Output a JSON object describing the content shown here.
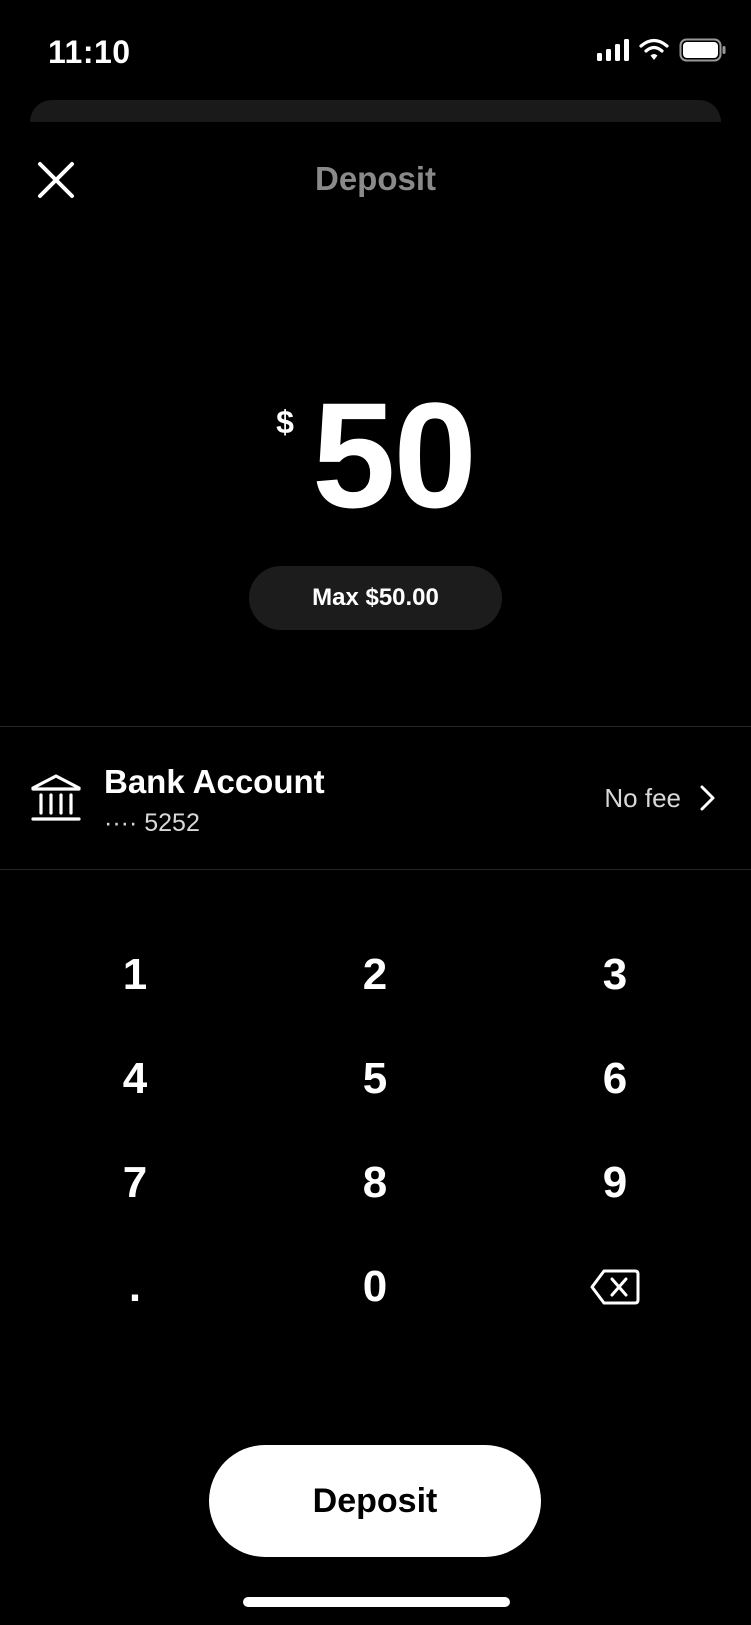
{
  "status_bar": {
    "time": "11:10"
  },
  "header": {
    "title": "Deposit"
  },
  "amount": {
    "currency_symbol": "$",
    "value": "50",
    "max_label": "Max $50.00"
  },
  "account": {
    "name": "Bank Account",
    "number_masked": "···· 5252",
    "fee_label": "No fee"
  },
  "keypad": {
    "keys": [
      "1",
      "2",
      "3",
      "4",
      "5",
      "6",
      "7",
      "8",
      "9",
      ".",
      "0"
    ]
  },
  "actions": {
    "deposit_label": "Deposit"
  },
  "colors": {
    "background": "#000000",
    "title_gray": "#8a8a8a",
    "pill_bg": "#1c1c1c",
    "button_bg": "#ffffff"
  }
}
